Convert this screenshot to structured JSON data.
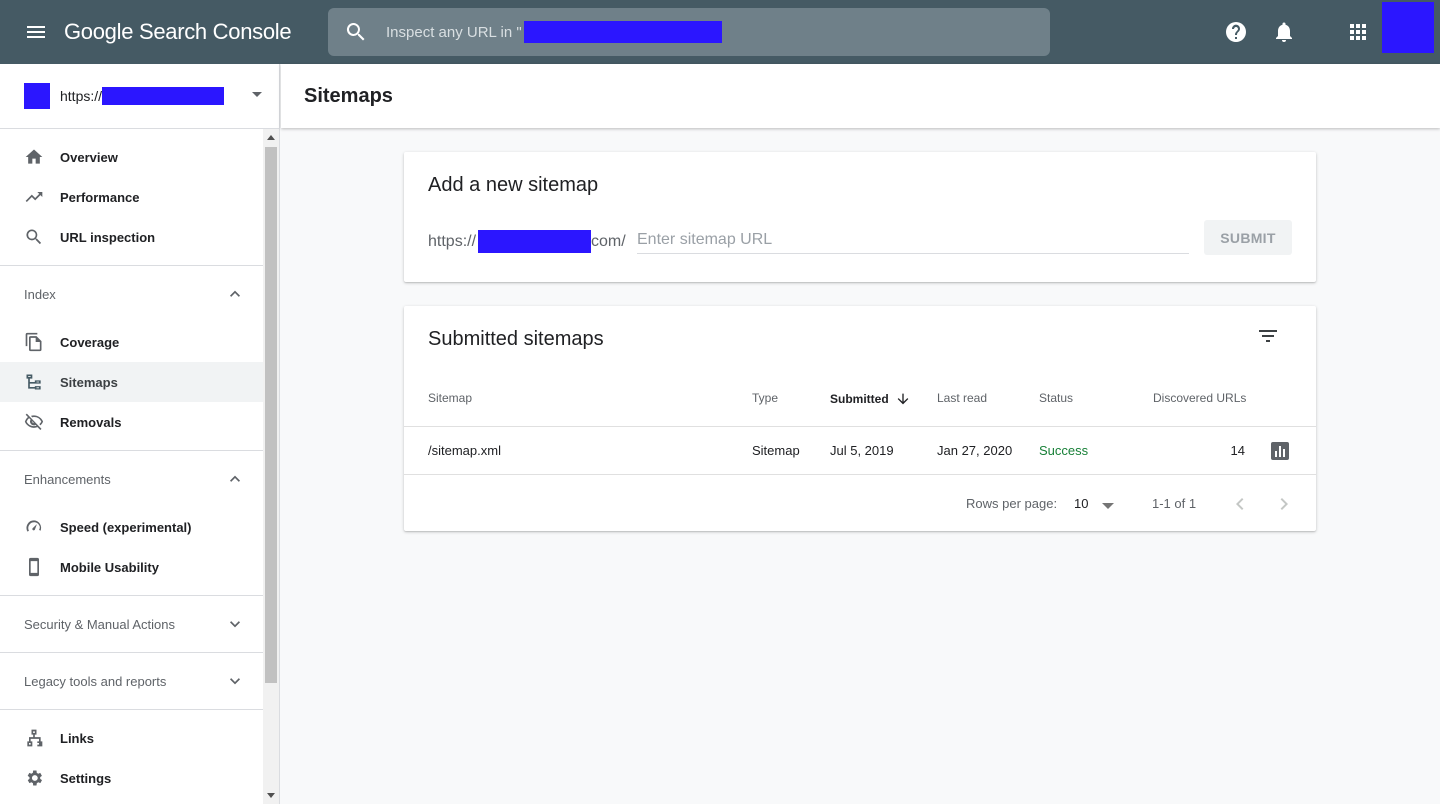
{
  "topbar": {
    "title": "Google Search Console",
    "search_placeholder": "Inspect any URL in \""
  },
  "property": {
    "url_prefix": "https://"
  },
  "sidebar": {
    "top_items": [
      {
        "label": "Overview",
        "icon": "home-icon"
      },
      {
        "label": "Performance",
        "icon": "trending-up-icon"
      },
      {
        "label": "URL inspection",
        "icon": "search-icon"
      }
    ],
    "index": {
      "header": "Index",
      "items": [
        {
          "label": "Coverage",
          "icon": "copy-pages-icon"
        },
        {
          "label": "Sitemaps",
          "icon": "sitemap-icon"
        },
        {
          "label": "Removals",
          "icon": "eye-off-icon"
        }
      ]
    },
    "enhancements": {
      "header": "Enhancements",
      "items": [
        {
          "label": "Speed (experimental)",
          "icon": "speedometer-icon"
        },
        {
          "label": "Mobile Usability",
          "icon": "phone-icon"
        }
      ]
    },
    "security_header": "Security & Manual Actions",
    "legacy_header": "Legacy tools and reports",
    "bottom_items": [
      {
        "label": "Links",
        "icon": "links-icon"
      },
      {
        "label": "Settings",
        "icon": "gear-icon"
      }
    ]
  },
  "page": {
    "title": "Sitemaps"
  },
  "add_sitemap": {
    "title": "Add a new sitemap",
    "prefix_start": "https://",
    "prefix_end": "com/",
    "placeholder": "Enter sitemap URL",
    "submit_label": "SUBMIT"
  },
  "submitted": {
    "title": "Submitted sitemaps",
    "columns": {
      "sitemap": "Sitemap",
      "type": "Type",
      "submitted": "Submitted",
      "last_read": "Last read",
      "status": "Status",
      "discovered": "Discovered URLs"
    },
    "rows": [
      {
        "sitemap": "/sitemap.xml",
        "type": "Sitemap",
        "submitted": "Jul 5, 2019",
        "last_read": "Jan 27, 2020",
        "status": "Success",
        "discovered": "14"
      }
    ],
    "pagination": {
      "rows_per_page_label": "Rows per page:",
      "rows_per_page_value": "10",
      "range": "1-1 of 1"
    }
  },
  "colors": {
    "topbar": "#455a64",
    "redaction": "#2b16ff",
    "success": "#188038"
  }
}
